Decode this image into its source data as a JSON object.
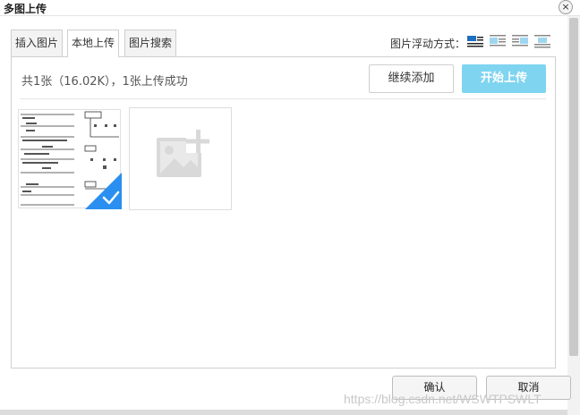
{
  "dialog": {
    "title": "多图上传",
    "close_glyph": "×"
  },
  "tabs": [
    {
      "label": "插入图片",
      "active": false
    },
    {
      "label": "本地上传",
      "active": true
    },
    {
      "label": "图片搜索",
      "active": false
    }
  ],
  "float": {
    "label": "图片浮动方式：",
    "options": [
      "float-none-icon",
      "float-left-icon",
      "float-right-icon",
      "float-center-icon"
    ]
  },
  "upload": {
    "info": "共1张（16.02K），1张上传成功",
    "continue_label": "继续添加",
    "start_label": "开始上传"
  },
  "footer": {
    "ok_label": "确认",
    "cancel_label": "取消"
  },
  "watermark": "https://blog.csdn.net/WSWTPSWLT",
  "colors": {
    "accent": "#7fd4f0",
    "check": "#2a8ff0"
  }
}
